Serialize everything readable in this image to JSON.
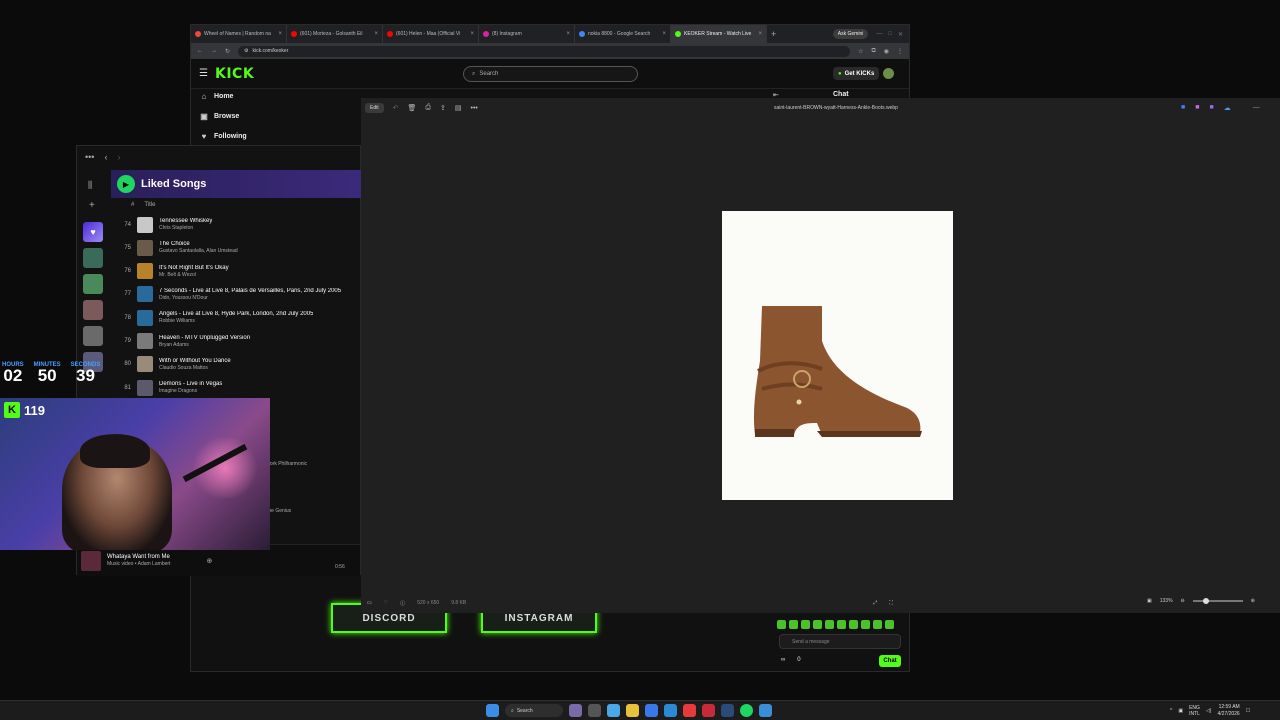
{
  "browser": {
    "tabs": [
      {
        "label": "Wheel of Names | Random na",
        "color": "#e94b3c",
        "active": false
      },
      {
        "label": "(601) Morteza - Golsanth Eil",
        "color": "#ff0000",
        "active": false
      },
      {
        "label": "(601) Helen - Maa (Official Vi",
        "color": "#ff0000",
        "active": false
      },
      {
        "label": "(8) Instagram",
        "color": "#d6249f",
        "active": false
      },
      {
        "label": "nokia 8800 - Google Search",
        "color": "#4285f4",
        "active": false
      },
      {
        "label": "KEOKER Stream - Watch Live",
        "color": "#53fc18",
        "active": true
      }
    ],
    "new_tab": "+",
    "gemini": "Ask Gemini",
    "url": "kick.com/keoker"
  },
  "kick": {
    "logo": "KICK",
    "search_placeholder": "Search",
    "get_kicks": "Get KICKs",
    "nav": [
      {
        "label": "Home",
        "icon": "⌂"
      },
      {
        "label": "Browse",
        "icon": "▣"
      },
      {
        "label": "Following",
        "icon": "♥"
      }
    ],
    "chat_title": "Chat",
    "chat_placeholder": "Send a message",
    "chat_button": "Chat",
    "chat_stats": [
      "∞",
      "0"
    ],
    "discord": "DISCORD",
    "instagram": "INSTAGRAM"
  },
  "spotify": {
    "playlist_title": "Liked Songs",
    "col_num": "#",
    "col_title": "Title",
    "songs": [
      {
        "num": "74",
        "title": "Tennessee Whiskey",
        "artist": "Chris Stapleton",
        "color": "#c8c8c8"
      },
      {
        "num": "75",
        "title": "The Choice",
        "artist": "Gustavo Santaolalla, Alan Umstead",
        "color": "#6a5a4a"
      },
      {
        "num": "76",
        "title": "It's Not Right But It's Okay",
        "artist": "Mr. Belt & Wezol",
        "color": "#b8822a"
      },
      {
        "num": "77",
        "title": "7 Seconds - Live at Live 8, Palais de Versailles, Paris, 2nd July 2005",
        "artist": "Dido, Youssou N'Dour",
        "color": "#2a6a9a"
      },
      {
        "num": "78",
        "title": "Angels - Live at Live 8, Hyde Park, London, 2nd July 2005",
        "artist": "Robbie Williams",
        "color": "#2a6a9a"
      },
      {
        "num": "79",
        "title": "Heaven - MTV Unplugged Version",
        "artist": "Bryan Adams",
        "color": "#7a7a7a"
      },
      {
        "num": "80",
        "title": "With or Without You Dance",
        "artist": "Claudio Souza Mattos",
        "color": "#9a8a7a"
      },
      {
        "num": "81",
        "title": "Demons - Live in Vegas",
        "artist": "Imagine Dragons",
        "color": "#5a5a6a"
      }
    ],
    "partial_1": "York Philharmonic",
    "partial_2": "me Genius",
    "now_playing_title": "Whataya Want from Me",
    "now_playing_sub": "Music video • Adam Lambert",
    "now_playing_time": "0:56"
  },
  "timer": {
    "hours_label": "HOURS",
    "hours": "02",
    "minutes_label": "MINUTES",
    "minutes": "50",
    "seconds_label": "SECONDS",
    "seconds": "39"
  },
  "webcam": {
    "badge_num": "119"
  },
  "viewer": {
    "edit_label": "Edit",
    "filename": "saint-laurent-BROWN-wyatt-Harness-Ankle-Boots.webp",
    "dimensions": "520 x 650",
    "size": "9.8 KB",
    "zoom": "133%"
  },
  "taskbar": {
    "search": "Search",
    "lang": "ENG",
    "region": "INTL",
    "time": "12:59 AM",
    "date": "4/27/2026"
  }
}
